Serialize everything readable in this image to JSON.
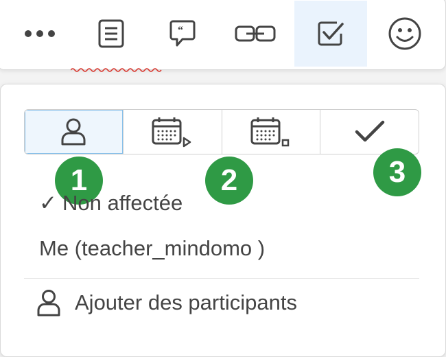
{
  "toolbar": {
    "buttons": [
      {
        "name": "more",
        "icon": "more-dots-icon"
      },
      {
        "name": "notes",
        "icon": "note-icon"
      },
      {
        "name": "comment",
        "icon": "comment-quote-icon"
      },
      {
        "name": "link",
        "icon": "link-icon"
      },
      {
        "name": "task",
        "icon": "checkbox-icon",
        "active": true
      },
      {
        "name": "emoji",
        "icon": "smiley-icon"
      }
    ]
  },
  "task_panel": {
    "segments": [
      {
        "icon": "person-icon",
        "selected": true
      },
      {
        "icon": "calendar-start-icon",
        "selected": false
      },
      {
        "icon": "calendar-end-icon",
        "selected": false
      },
      {
        "icon": "checkmark-icon",
        "selected": false
      }
    ],
    "badges": [
      "1",
      "2",
      "3"
    ],
    "assignee_options": [
      {
        "check": "✓",
        "label": "Non affectée",
        "checked": true
      },
      {
        "label": "Me (teacher_mindomo )",
        "checked": false
      }
    ],
    "add_participants_label": "Ajouter des participants"
  },
  "colors": {
    "badge": "#2f9a45",
    "active_bg": "#eaf3fd",
    "selected_border": "#86c0ea",
    "icon": "#444444"
  }
}
